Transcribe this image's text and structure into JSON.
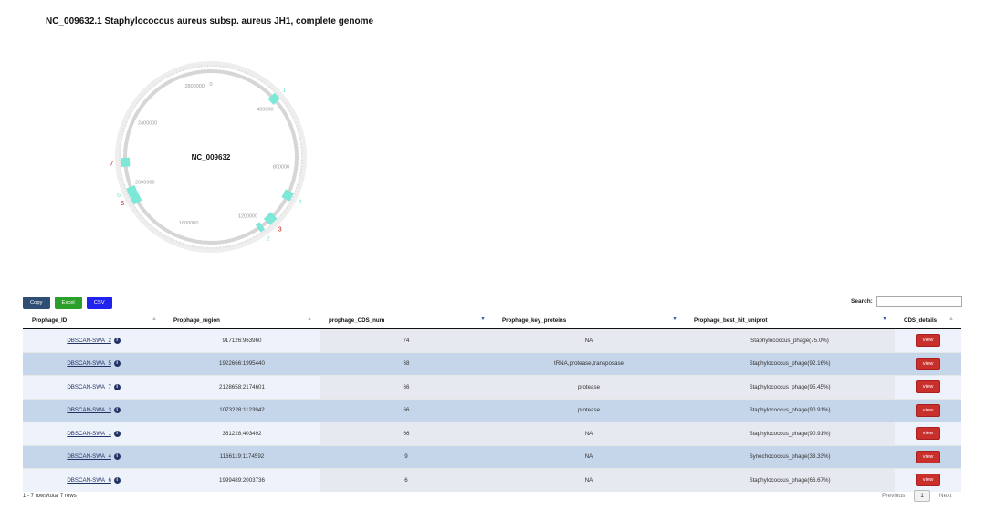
{
  "title": "NC_009632.1 Staphylococcus aureus subsp. aureus JH1, complete genome",
  "genome_map": {
    "center_label": "NC_009632",
    "total_length": 2906700,
    "tick_labels": [
      "0",
      "400000",
      "800000",
      "1200000",
      "1600000",
      "2000000",
      "2400000",
      "2800000"
    ],
    "phage_labels": [
      "1",
      "2",
      "3",
      "4",
      "5",
      "6",
      "7"
    ],
    "colors": {
      "phage": "#7ee8d8",
      "ring": "#d6d6d6",
      "num_red": "#cc2222",
      "num_teal": "#7ee8d8"
    }
  },
  "buttons": {
    "copy": "Copy",
    "excel": "Excel",
    "csv": "CSV"
  },
  "search": {
    "label": "Search:",
    "value": ""
  },
  "table": {
    "headers": [
      "Prophage_ID",
      "Prophage_region",
      "prophage_CDS_num",
      "Prophage_key_proteins",
      "Prophage_best_hit_uniprot",
      "CDS_details"
    ],
    "rows": [
      {
        "id": "DBSCAN-SWA_2",
        "region": "917126:963960",
        "cds": "74",
        "key": "NA",
        "hit": "Staphylococcus_phage(75.0%)",
        "action": "view"
      },
      {
        "id": "DBSCAN-SWA_5",
        "region": "1922666:1995440",
        "cds": "68",
        "key": "tRNA,protease,transposase",
        "hit": "Staphylococcus_phage(92.16%)",
        "action": "view"
      },
      {
        "id": "DBSCAN-SWA_7",
        "region": "2128658:2174601",
        "cds": "66",
        "key": "protease",
        "hit": "Staphylococcus_phage(95.45%)",
        "action": "view"
      },
      {
        "id": "DBSCAN-SWA_3",
        "region": "1073228:1123942",
        "cds": "66",
        "key": "protease",
        "hit": "Staphylococcus_phage(90.91%)",
        "action": "view"
      },
      {
        "id": "DBSCAN-SWA_1",
        "region": "361228:403492",
        "cds": "66",
        "key": "NA",
        "hit": "Staphylococcus_phage(90.91%)",
        "action": "view"
      },
      {
        "id": "DBSCAN-SWA_4",
        "region": "1166119:1174592",
        "cds": "9",
        "key": "NA",
        "hit": "Synechococcus_phage(33.33%)",
        "action": "view"
      },
      {
        "id": "DBSCAN-SWA_6",
        "region": "1999489:2003736",
        "cds": "6",
        "key": "NA",
        "hit": "Staphylococcus_phage(66.67%)",
        "action": "view"
      }
    ]
  },
  "footer": {
    "info": "1 - 7 rows/total 7 rows",
    "previous": "Previous",
    "page": "1",
    "next": "Next"
  }
}
